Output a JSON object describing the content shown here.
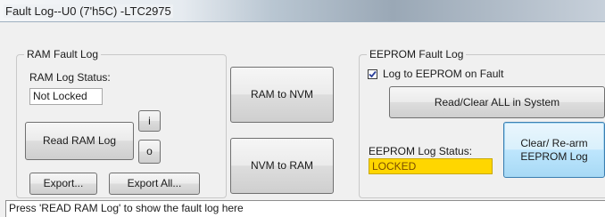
{
  "window": {
    "title": "Fault Log--U0 (7'h5C) -LTC2975"
  },
  "ram_group": {
    "legend": "RAM Fault Log",
    "status_label": "RAM Log Status:",
    "status_value": "Not Locked",
    "read_button": "Read RAM Log",
    "i_button": "i",
    "o_button": "o",
    "export_button": "Export...",
    "export_all_button": "Export All..."
  },
  "transfer": {
    "ram_to_nvm": "RAM to NVM",
    "nvm_to_ram": "NVM to RAM"
  },
  "eeprom_group": {
    "legend": "EEPROM Fault Log",
    "log_checkbox_label": "Log to EEPROM on Fault",
    "log_checked": true,
    "read_clear_button": "Read/Clear ALL in System",
    "status_label": "EEPROM Log Status:",
    "status_value": "LOCKED",
    "clear_rearm_button_line1": "Clear/ Re-arm",
    "clear_rearm_button_line2": "EEPROM Log",
    "locked_color": "#ffd600"
  },
  "status": {
    "message": "Press 'READ RAM Log' to show the fault log here"
  }
}
